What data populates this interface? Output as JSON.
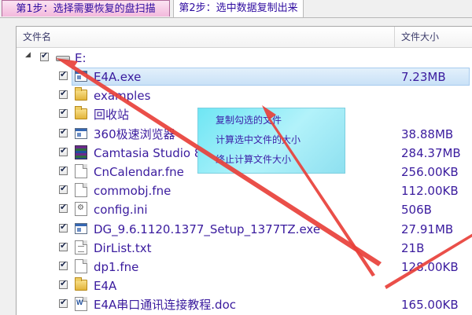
{
  "tabs": [
    {
      "label": "第1步：选择需要恢复的盘扫描"
    },
    {
      "label": "第2步：选中数据复制出来"
    }
  ],
  "columns": {
    "name": "文件名",
    "size": "文件大小"
  },
  "drive": {
    "label": "E:"
  },
  "files": [
    {
      "name": "E4A.exe",
      "size": "7.23MB",
      "icon": "exe-icon",
      "checked": true,
      "selected": true
    },
    {
      "name": "examples",
      "size": "",
      "icon": "folder-icon",
      "checked": true
    },
    {
      "name": "回收站",
      "size": "",
      "icon": "folder-icon",
      "checked": true
    },
    {
      "name": "360极速浏览器",
      "size": "38.88MB",
      "icon": "exe-icon",
      "checked": true
    },
    {
      "name": "Camtasia Studio 8.6.zip",
      "size": "284.37MB",
      "icon": "zip-icon",
      "checked": true
    },
    {
      "name": "CnCalendar.fne",
      "size": "256.00KB",
      "icon": "file-icon",
      "checked": true
    },
    {
      "name": "commobj.fne",
      "size": "112.00KB",
      "icon": "file-icon",
      "checked": true
    },
    {
      "name": "config.ini",
      "size": "506B",
      "icon": "ini-icon",
      "checked": true
    },
    {
      "name": "DG_9.6.1120.1377_Setup_1377TZ.exe",
      "size": "27.91MB",
      "icon": "exe-icon",
      "checked": true
    },
    {
      "name": "DirList.txt",
      "size": "21B",
      "icon": "txt-icon",
      "checked": true
    },
    {
      "name": "dp1.fne",
      "size": "128.00KB",
      "icon": "file-icon",
      "checked": true
    },
    {
      "name": "E4A",
      "size": "",
      "icon": "folder-icon",
      "checked": true
    },
    {
      "name": "E4A串口通讯连接教程.doc",
      "size": "165.00KB",
      "icon": "doc-icon",
      "checked": true
    }
  ],
  "context_menu": [
    {
      "label": "复制勾选的文件"
    },
    {
      "label": "计算选中文件的大小"
    },
    {
      "label": "终止计算文件大小"
    }
  ],
  "colors": {
    "text": "#3a1b9e",
    "arrow": "#e8403a",
    "menu_bg": "#a9eef8"
  }
}
